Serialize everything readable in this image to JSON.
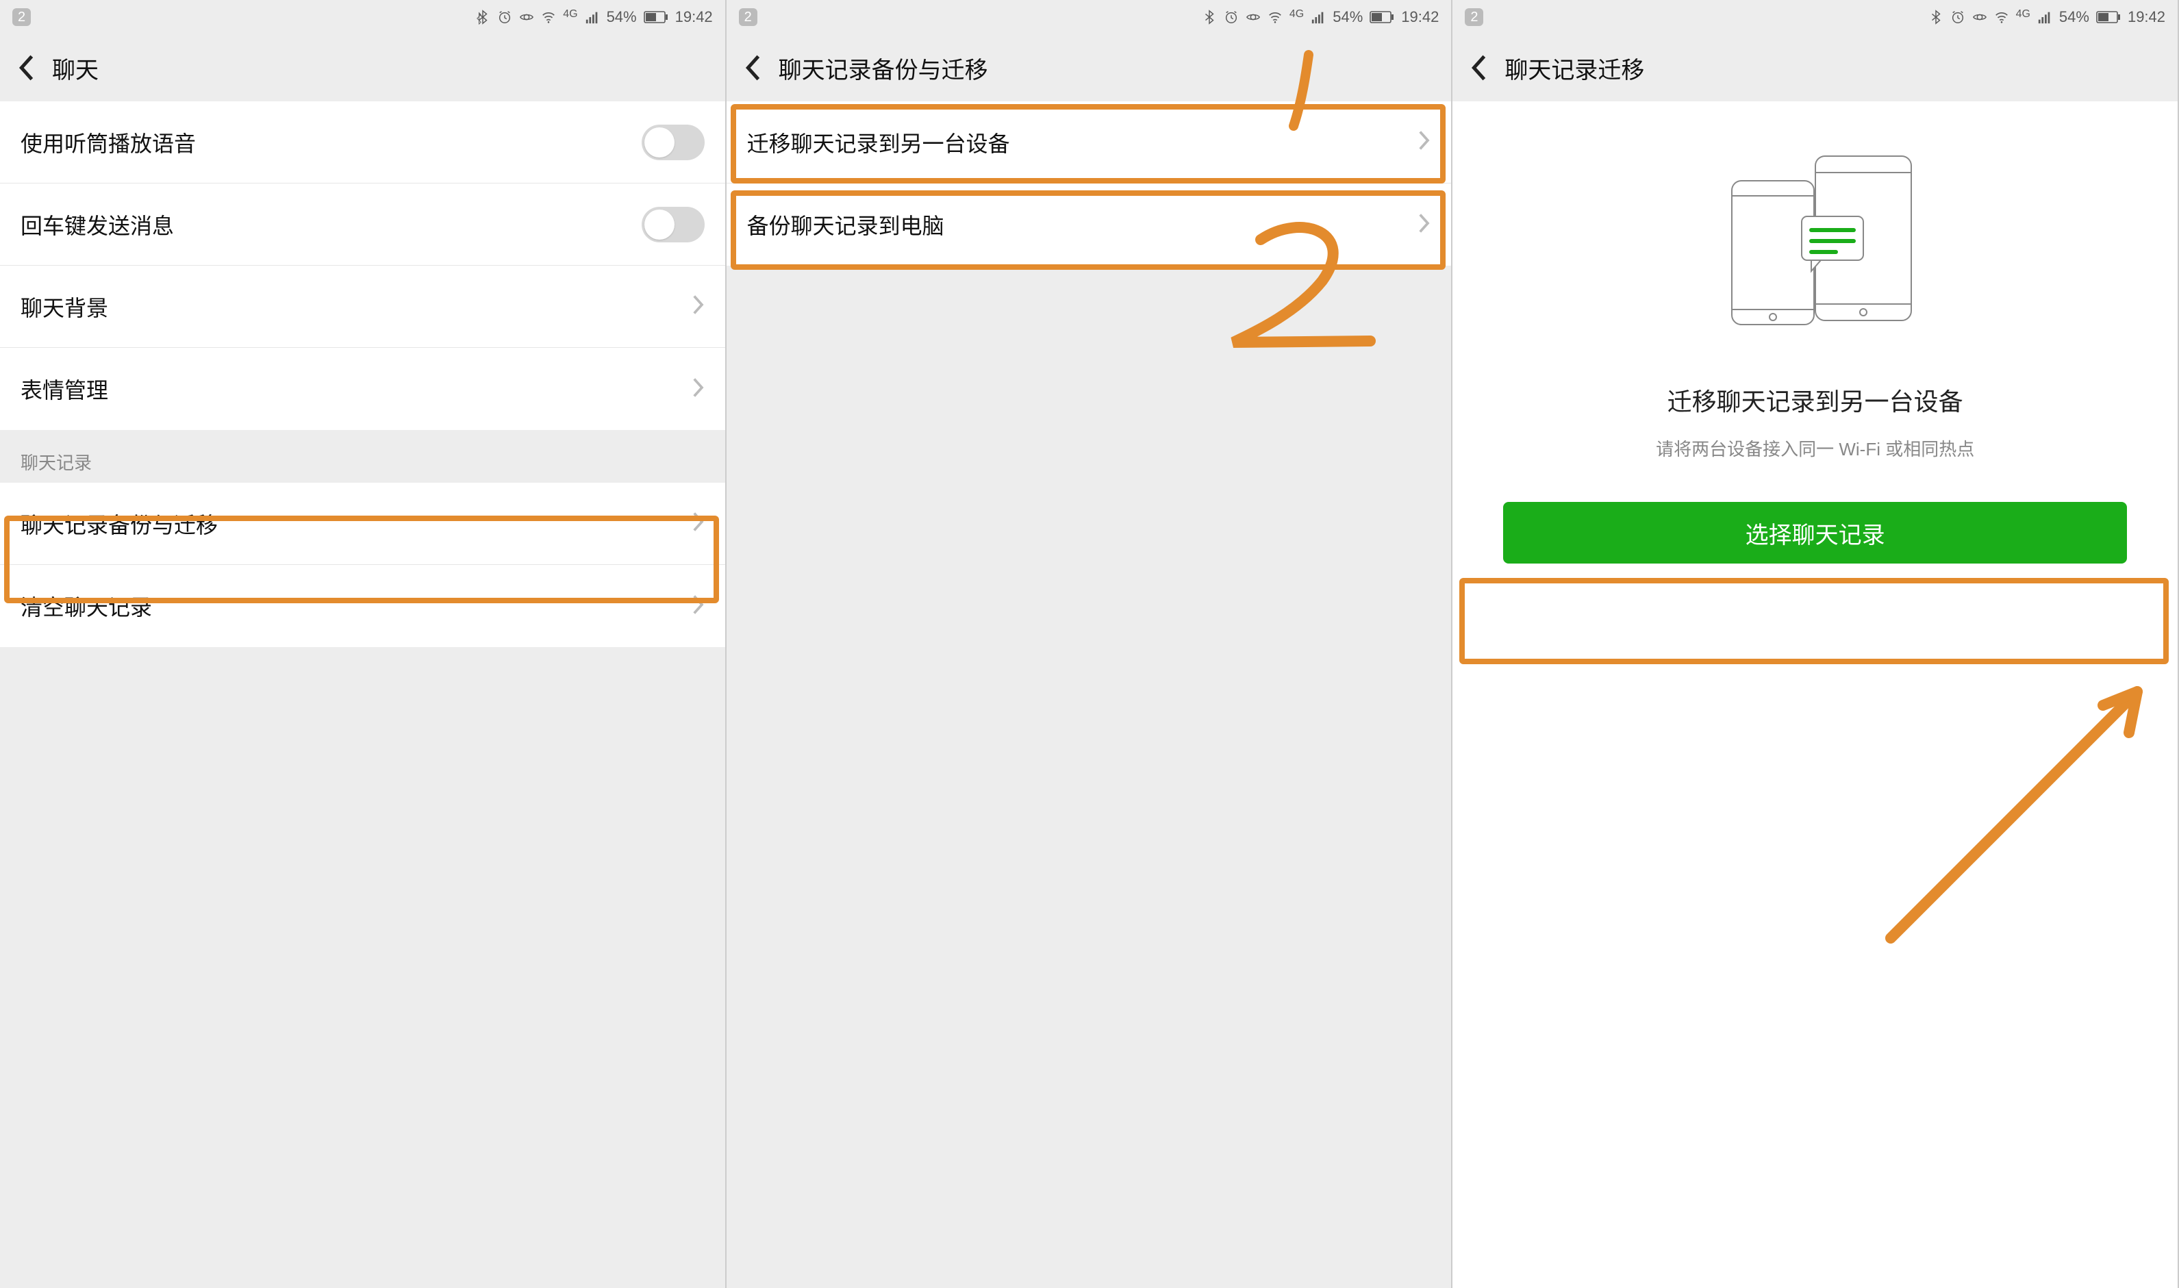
{
  "status": {
    "notif_count": "2",
    "network_label": "4G",
    "battery_pct": "54%",
    "time": "19:42"
  },
  "screen1": {
    "title": "聊天",
    "items": {
      "earpiece": "使用听筒播放语音",
      "enter_send": "回车键发送消息",
      "chat_bg": "聊天背景",
      "sticker_mgmt": "表情管理"
    },
    "section_header": "聊天记录",
    "items2": {
      "backup_migrate": "聊天记录备份与迁移",
      "clear": "清空聊天记录"
    }
  },
  "screen2": {
    "title": "聊天记录备份与迁移",
    "items": {
      "migrate_device": "迁移聊天记录到另一台设备",
      "backup_pc": "备份聊天记录到电脑"
    },
    "annotations": {
      "num1": "1",
      "num2": "2"
    }
  },
  "screen3": {
    "title": "聊天记录迁移",
    "heading": "迁移聊天记录到另一台设备",
    "subtext": "请将两台设备接入同一 Wi-Fi 或相同热点",
    "button": "选择聊天记录"
  },
  "colors": {
    "highlight": "#e38b2d",
    "primary": "#1aad19"
  }
}
